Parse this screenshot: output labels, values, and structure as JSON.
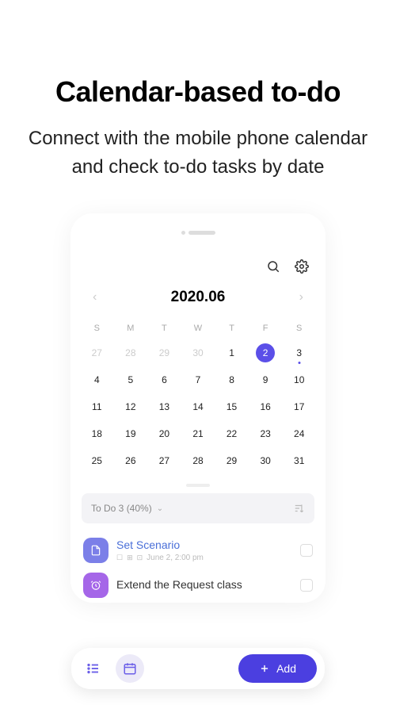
{
  "hero": {
    "title": "Calendar-based to-do",
    "subtitle": "Connect with the mobile phone calendar and check to-do tasks by date"
  },
  "calendar": {
    "title": "2020.06",
    "weekdays": [
      "S",
      "M",
      "T",
      "W",
      "T",
      "F",
      "S"
    ],
    "days": [
      {
        "n": "27",
        "dim": true
      },
      {
        "n": "28",
        "dim": true
      },
      {
        "n": "29",
        "dim": true
      },
      {
        "n": "30",
        "dim": true
      },
      {
        "n": "1"
      },
      {
        "n": "2",
        "today": true
      },
      {
        "n": "3",
        "event": true
      },
      {
        "n": "4"
      },
      {
        "n": "5"
      },
      {
        "n": "6"
      },
      {
        "n": "7"
      },
      {
        "n": "8"
      },
      {
        "n": "9"
      },
      {
        "n": "10"
      },
      {
        "n": "11"
      },
      {
        "n": "12"
      },
      {
        "n": "13"
      },
      {
        "n": "14"
      },
      {
        "n": "15"
      },
      {
        "n": "16"
      },
      {
        "n": "17"
      },
      {
        "n": "18"
      },
      {
        "n": "19"
      },
      {
        "n": "20"
      },
      {
        "n": "21"
      },
      {
        "n": "22"
      },
      {
        "n": "23"
      },
      {
        "n": "24"
      },
      {
        "n": "25"
      },
      {
        "n": "26"
      },
      {
        "n": "27"
      },
      {
        "n": "28"
      },
      {
        "n": "29"
      },
      {
        "n": "30"
      },
      {
        "n": "31"
      }
    ]
  },
  "todo": {
    "header": "To Do 3 (40%)",
    "tasks": [
      {
        "title": "Set Scenario",
        "meta": "June 2, 2:00 pm",
        "highlight": true,
        "icon": "document"
      },
      {
        "title": "Extend the Request class",
        "meta": "",
        "icon": "alarm"
      }
    ]
  },
  "bottomBar": {
    "addLabel": "Add"
  }
}
